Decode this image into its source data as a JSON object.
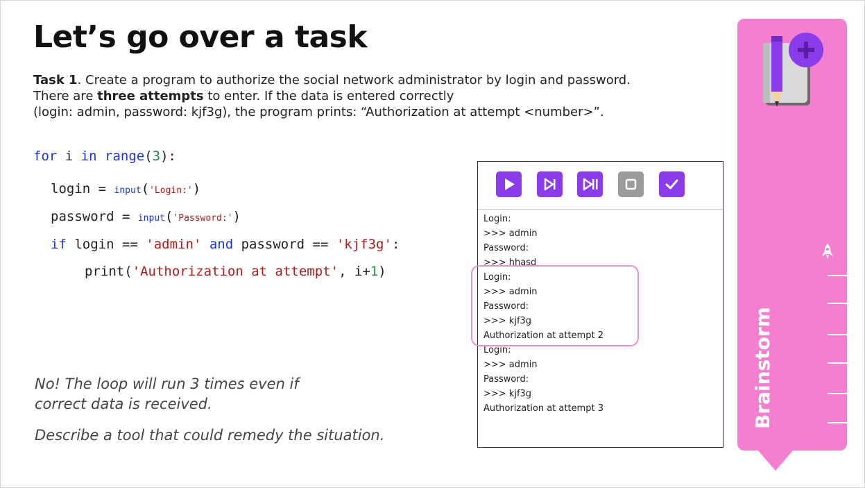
{
  "slide": {
    "title": "Let’s go over a task",
    "task": {
      "label": "Task 1",
      "text1": ". Create a program to authorize the social network administrator by login and password.",
      "text2": "There are ",
      "bold2": "three attempts",
      "text3": " to enter. If the data is entered correctly",
      "text4": "(login: admin, password: kjf3g), the program prints: “Authorization at attempt <number>”."
    },
    "code": {
      "l1_for": "for",
      "l1_i": " i ",
      "l1_in": "in",
      "l1_space": " ",
      "l1_range": "range",
      "l1_open": "(",
      "l1_num": "3",
      "l1_close": "):",
      "l2_var": "login = ",
      "l2_fn": "input",
      "l2_open": "(",
      "l2_str": "'Login:'",
      "l2_close": ")",
      "l3_var": "password = ",
      "l3_fn": "input",
      "l3_open": "(",
      "l3_str": "'Password:'",
      "l3_close": ")",
      "l4_if": "if",
      "l4_a": " login == ",
      "l4_s1": "'admin'",
      "l4_sp": " ",
      "l4_and": "and",
      "l4_b": " password == ",
      "l4_s2": "'kjf3g'",
      "l4_c": ":",
      "l5_fn": "print(",
      "l5_str": "'Authorization at attempt'",
      "l5_a": ", i+",
      "l5_num": "1",
      "l5_b": ")"
    },
    "answer_line1": "No! The loop will run 3 times even if",
    "answer_line2": "correct data is received.",
    "question": "Describe a tool that could remedy the situation."
  },
  "console": {
    "buttons": [
      {
        "name": "run-button",
        "icon": "play-icon",
        "color": "#8a3bea"
      },
      {
        "name": "step-button",
        "icon": "step-icon",
        "color": "#8a3bea"
      },
      {
        "name": "step-over-button",
        "icon": "skip-icon",
        "color": "#8a3bea"
      },
      {
        "name": "stop-button",
        "icon": "stop-icon",
        "color": "#9b9b9b"
      },
      {
        "name": "check-button",
        "icon": "check-icon",
        "color": "#8a3bea"
      }
    ],
    "output": [
      "Login:",
      ">>> admin",
      "Password:",
      ">>> hhasd",
      "Login:",
      ">>> admin",
      "Password:",
      ">>> kjf3g",
      "Authorization at attempt 2",
      "Login:",
      ">>> admin",
      "Password:",
      ">>> kjf3g",
      "Authorization at attempt 3"
    ]
  },
  "sidebar": {
    "label": "Brainstorm",
    "color": "#f47fd0",
    "icons": [
      "notebook-pencil-plus-icon",
      "rocket-icon"
    ]
  }
}
